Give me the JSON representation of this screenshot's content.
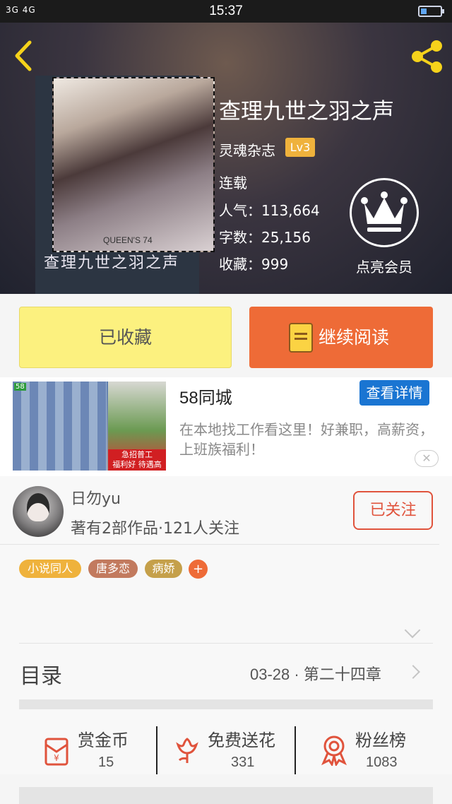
{
  "status_bar": {
    "time": "15:37",
    "signal": "3G 4G"
  },
  "book": {
    "title": "查理九世之羽之声",
    "cover_text": "查理九世之羽之声",
    "cover_small": "QUEEN'S 74",
    "author": "灵魂杂志",
    "level": "Lv3",
    "status": "连载",
    "popularity": "人气：113,664",
    "word_count": "字数：25,156",
    "favorites": "收藏：999"
  },
  "vip": {
    "label": "点亮会员"
  },
  "actions": {
    "favorited_label": "已收藏",
    "continue_label": "继续阅读"
  },
  "ad": {
    "title": "58同城",
    "detail_button": "查看详情",
    "description": "在本地找工作看这里！好兼职，高薪资，上班族福利！",
    "image_tag_line1": "急招普工",
    "image_tag_line2": "福利好 待遇高",
    "image_logo": "58"
  },
  "author_info": {
    "handle": "日勿yu",
    "stats": "著有2部作品·121人关注",
    "follow_button": "已关注"
  },
  "tags": [
    {
      "label": "小说同人",
      "color": "#efb23c"
    },
    {
      "label": "唐多恋",
      "color": "#c27a5e"
    },
    {
      "label": "病娇",
      "color": "#c5a04a"
    }
  ],
  "tag_add": "+",
  "toc": {
    "label": "目录",
    "latest": "03-28 · 第二十四章"
  },
  "stats": [
    {
      "label": "赏金币",
      "value": "15"
    },
    {
      "label": "免费送花",
      "value": "331"
    },
    {
      "label": "粉丝榜",
      "value": "1083"
    }
  ],
  "colors": {
    "accent": "#ee6b37",
    "favorite_button": "#fcf17f",
    "ad_button": "#1a75d2",
    "icon_red": "#e0533c"
  }
}
